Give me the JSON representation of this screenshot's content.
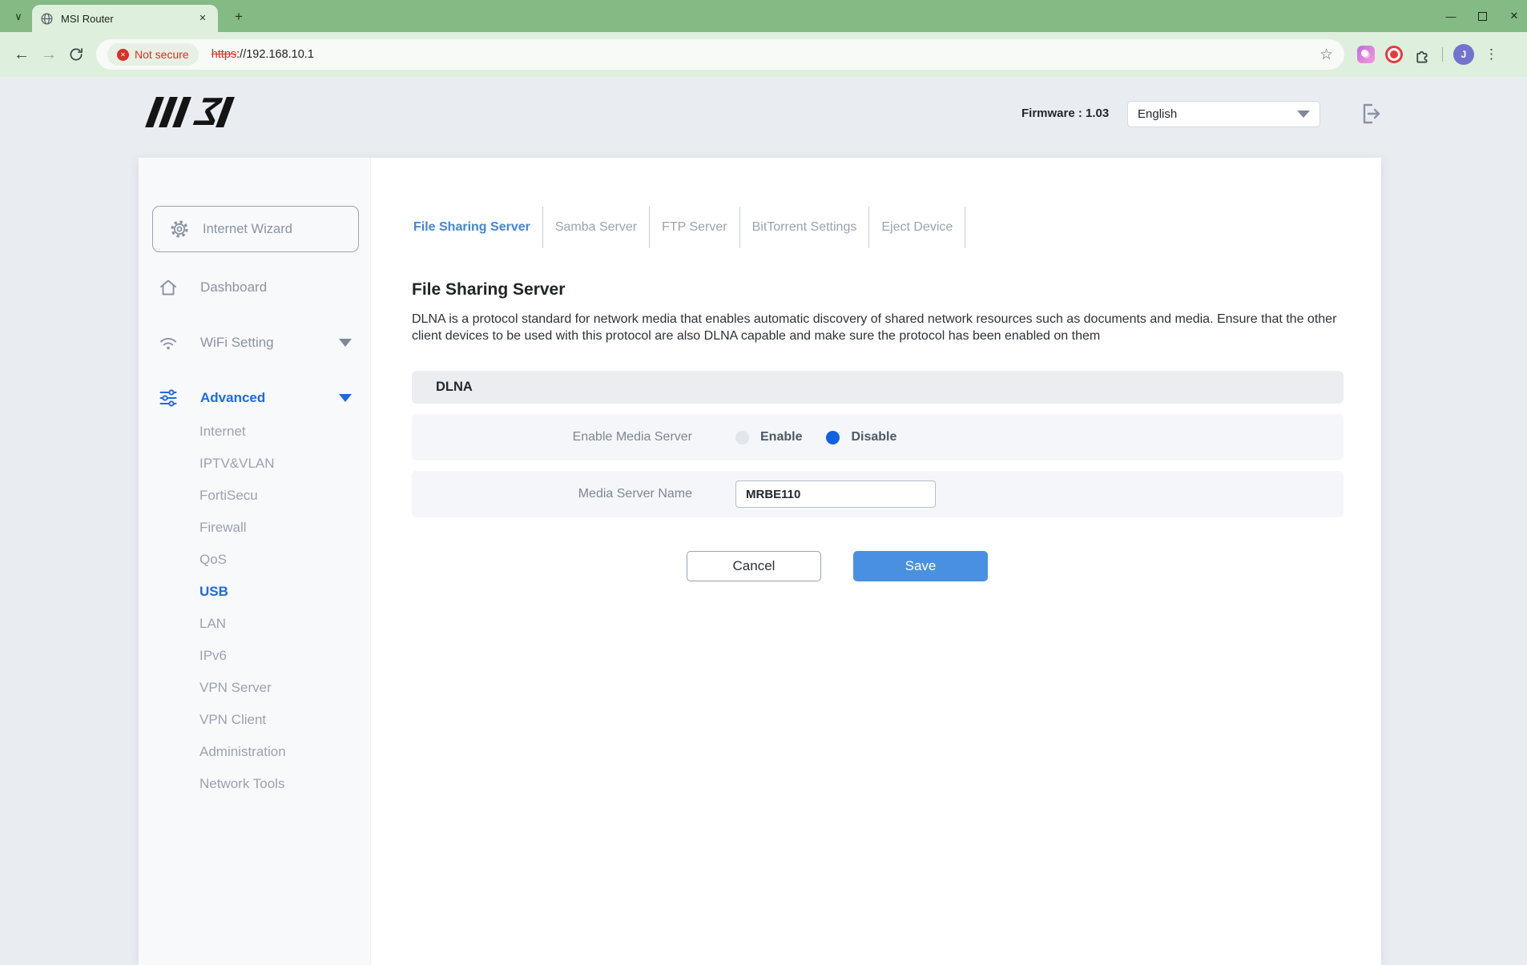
{
  "colors": {
    "accent_blue": "#1f6ae0",
    "tab_active_blue": "#4285d8",
    "radio_selected_blue": "#0f62e0",
    "save_button_blue": "#4a90e2",
    "danger_red": "#d93025",
    "titlebar_green": "#84ba84",
    "toolbar_green": "#def0dd"
  },
  "browser": {
    "tab_title": "MSI Router",
    "not_secure_label": "Not secure",
    "url_scheme": "https",
    "url_rest": "://192.168.10.1",
    "avatar_letter": "J",
    "icons": {
      "tab_chevron": "∨",
      "close_tab": "✕",
      "new_tab": "+",
      "minimize": "—",
      "close_window": "✕",
      "back": "←",
      "forward": "→",
      "star": "☆",
      "kebab": "⋮",
      "chip_x": "✕"
    }
  },
  "header": {
    "firmware_label": "Firmware : 1.03",
    "language_selected": "English"
  },
  "sidebar": {
    "wizard_label": "Internet Wizard",
    "dashboard_label": "Dashboard",
    "wifi_label": "WiFi Setting",
    "advanced_label": "Advanced",
    "advanced_children": [
      "Internet",
      "IPTV&VLAN",
      "FortiSecu",
      "Firewall",
      "QoS",
      "USB",
      "LAN",
      "IPv6",
      "VPN Server",
      "VPN Client",
      "Administration",
      "Network Tools"
    ],
    "active_child": "USB"
  },
  "main": {
    "tabs": [
      {
        "label": "File Sharing Server"
      },
      {
        "label": "Samba Server"
      },
      {
        "label": "FTP Server"
      },
      {
        "label": "BitTorrent Settings"
      },
      {
        "label": "Eject Device"
      }
    ],
    "active_tab": "File Sharing Server",
    "title": "File Sharing Server",
    "description": "DLNA is a protocol standard for network media that enables automatic discovery of shared network resources such as documents and media. Ensure that the other client devices to be used with this protocol are also DLNA capable and make sure the protocol has been enabled on them",
    "section_title": "DLNA",
    "enable_media_server": {
      "label": "Enable Media Server",
      "enable_option": "Enable",
      "disable_option": "Disable",
      "selected": "Disable"
    },
    "media_server_name": {
      "label": "Media Server Name",
      "value": "MRBE110"
    },
    "cancel_label": "Cancel",
    "save_label": "Save"
  }
}
